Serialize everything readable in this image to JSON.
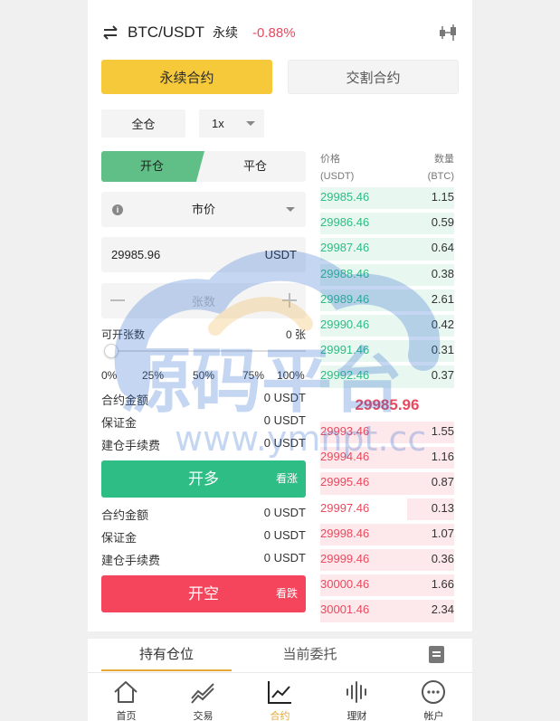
{
  "header": {
    "symbol": "BTC/USDT",
    "type": "永续",
    "change": "-0.88%"
  },
  "contract_tabs": {
    "perpetual": "永续合约",
    "delivery": "交割合约"
  },
  "margin_mode": "全仓",
  "leverage": "1x",
  "open_close": {
    "open": "开仓",
    "close": "平仓"
  },
  "order_type": "市价",
  "price_input": {
    "value": "29985.96",
    "unit": "USDT"
  },
  "qty_input": {
    "placeholder": "张数"
  },
  "available": {
    "label": "可开张数",
    "value": "0 张"
  },
  "slider_level_percent": 0,
  "percent_marks": [
    "0%",
    "25%",
    "50%",
    "75%",
    "100%"
  ],
  "long_info": {
    "rows": [
      {
        "label": "合约金额",
        "value": "0 USDT"
      },
      {
        "label": "保证金",
        "value": "0 USDT"
      },
      {
        "label": "建仓手续费",
        "value": "0 USDT"
      }
    ],
    "button": "开多",
    "hint": "看涨"
  },
  "short_info": {
    "rows": [
      {
        "label": "合约金额",
        "value": "0 USDT"
      },
      {
        "label": "保证金",
        "value": "0 USDT"
      },
      {
        "label": "建仓手续费",
        "value": "0 USDT"
      }
    ],
    "button": "开空",
    "hint": "看跌"
  },
  "orderbook": {
    "price_header": [
      "价格",
      "(USDT)"
    ],
    "qty_header": [
      "数量",
      "(BTC)"
    ],
    "buy": [
      {
        "price": "29985.46",
        "qty": "1.15"
      },
      {
        "price": "29986.46",
        "qty": "0.59"
      },
      {
        "price": "29987.46",
        "qty": "0.64"
      },
      {
        "price": "29988.46",
        "qty": "0.38"
      },
      {
        "price": "29989.46",
        "qty": "2.61"
      },
      {
        "price": "29990.46",
        "qty": "0.42"
      },
      {
        "price": "29991.46",
        "qty": "0.31"
      },
      {
        "price": "29992.46",
        "qty": "0.37"
      }
    ],
    "last_price": "29985.96",
    "sell": [
      {
        "price": "29993.46",
        "qty": "1.55"
      },
      {
        "price": "29994.46",
        "qty": "1.16"
      },
      {
        "price": "29995.46",
        "qty": "0.87"
      },
      {
        "price": "29997.46",
        "qty": "0.13"
      },
      {
        "price": "29998.46",
        "qty": "1.07"
      },
      {
        "price": "29999.46",
        "qty": "0.36"
      },
      {
        "price": "30000.46",
        "qty": "1.66"
      },
      {
        "price": "30001.46",
        "qty": "2.34"
      }
    ]
  },
  "positions_tabs": {
    "holding": "持有仓位",
    "orders": "当前委托"
  },
  "tabbar": [
    {
      "label": "首页",
      "icon": "home-icon"
    },
    {
      "label": "交易",
      "icon": "trade-icon"
    },
    {
      "label": "合约",
      "icon": "contract-icon"
    },
    {
      "label": "理财",
      "icon": "finance-icon"
    },
    {
      "label": "帐户",
      "icon": "account-icon"
    }
  ],
  "colors": {
    "accent": "#f6c93a",
    "up": "#2ebd85",
    "down": "#f5455c",
    "active_tab": "#e6a937"
  },
  "watermark": {
    "title": "源码平台",
    "url": "www.ymnpt.cc"
  }
}
